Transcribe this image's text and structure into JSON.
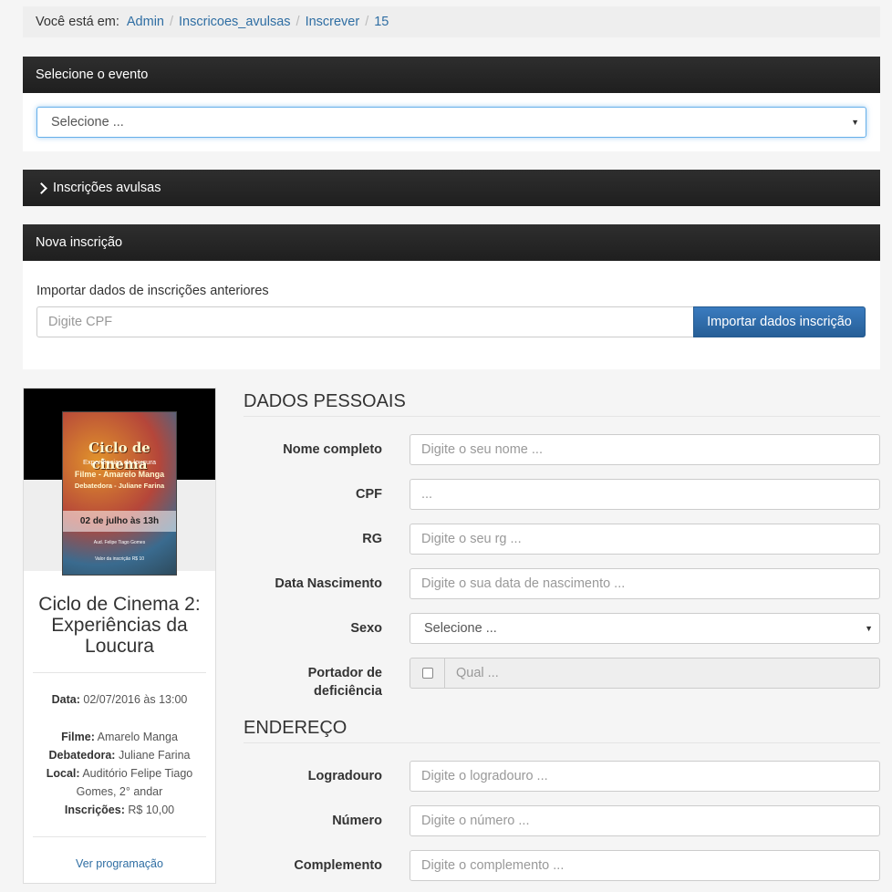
{
  "breadcrumb": {
    "lead": "Você está em:",
    "items": [
      "Admin",
      "Inscricoes_avulsas",
      "Inscrever",
      "15"
    ]
  },
  "event_panel": {
    "title": "Selecione o evento",
    "select_value": "Selecione ..."
  },
  "avulsas_panel": {
    "title": "Inscrições avulsas"
  },
  "nova_panel": {
    "title": "Nova inscrição",
    "import_label": "Importar dados de inscrições anteriores",
    "cpf_placeholder": "Digite CPF",
    "import_button": "Importar dados inscrição"
  },
  "event_card": {
    "poster": {
      "title": "Ciclo de cinema",
      "subtitle": "Experiências da loucura",
      "film_line": "Filme - Amarelo Manga",
      "debate_line": "Debatedora - Juliane Farina",
      "date_line": "02 de julho às 13h",
      "venue_line": "Aud. Felipe Tiago Gomes",
      "price_line": "Valor da inscrição R$ 10"
    },
    "title": "Ciclo de Cinema 2: Experiências da Loucura",
    "date_label": "Data:",
    "date_value": "02/07/2016 às 13:00",
    "film_label": "Filme:",
    "film_value": "Amarelo Manga",
    "debater_label": "Debatedora:",
    "debater_value": "Juliane Farina",
    "local_label": "Local:",
    "local_value": "Auditório Felipe Tiago Gomes, 2° andar",
    "inscricoes_label": "Inscrições:",
    "inscricoes_value": "R$ 10,00",
    "link": "Ver programação"
  },
  "personal": {
    "title": "DADOS PESSOAIS",
    "nome_label": "Nome completo",
    "nome_placeholder": "Digite o seu nome ...",
    "cpf_label": "CPF",
    "cpf_placeholder": "...",
    "rg_label": "RG",
    "rg_placeholder": "Digite o seu rg ...",
    "nasc_label": "Data Nascimento",
    "nasc_placeholder": "Digite o sua data de nascimento ...",
    "sexo_label": "Sexo",
    "sexo_value": "Selecione ...",
    "def_label_1": "Portador de",
    "def_label_2": "deficiência",
    "def_placeholder": "Qual ..."
  },
  "address": {
    "title": "ENDEREÇO",
    "logradouro_label": "Logradouro",
    "logradouro_placeholder": "Digite o logradouro ...",
    "numero_label": "Número",
    "numero_placeholder": "Digite o número ...",
    "complemento_label": "Complemento",
    "complemento_placeholder": "Digite o complemento ..."
  },
  "colors": {
    "header_dark": "#222222",
    "link": "#2f6ea3",
    "primary_button": "#2f6ea3"
  }
}
